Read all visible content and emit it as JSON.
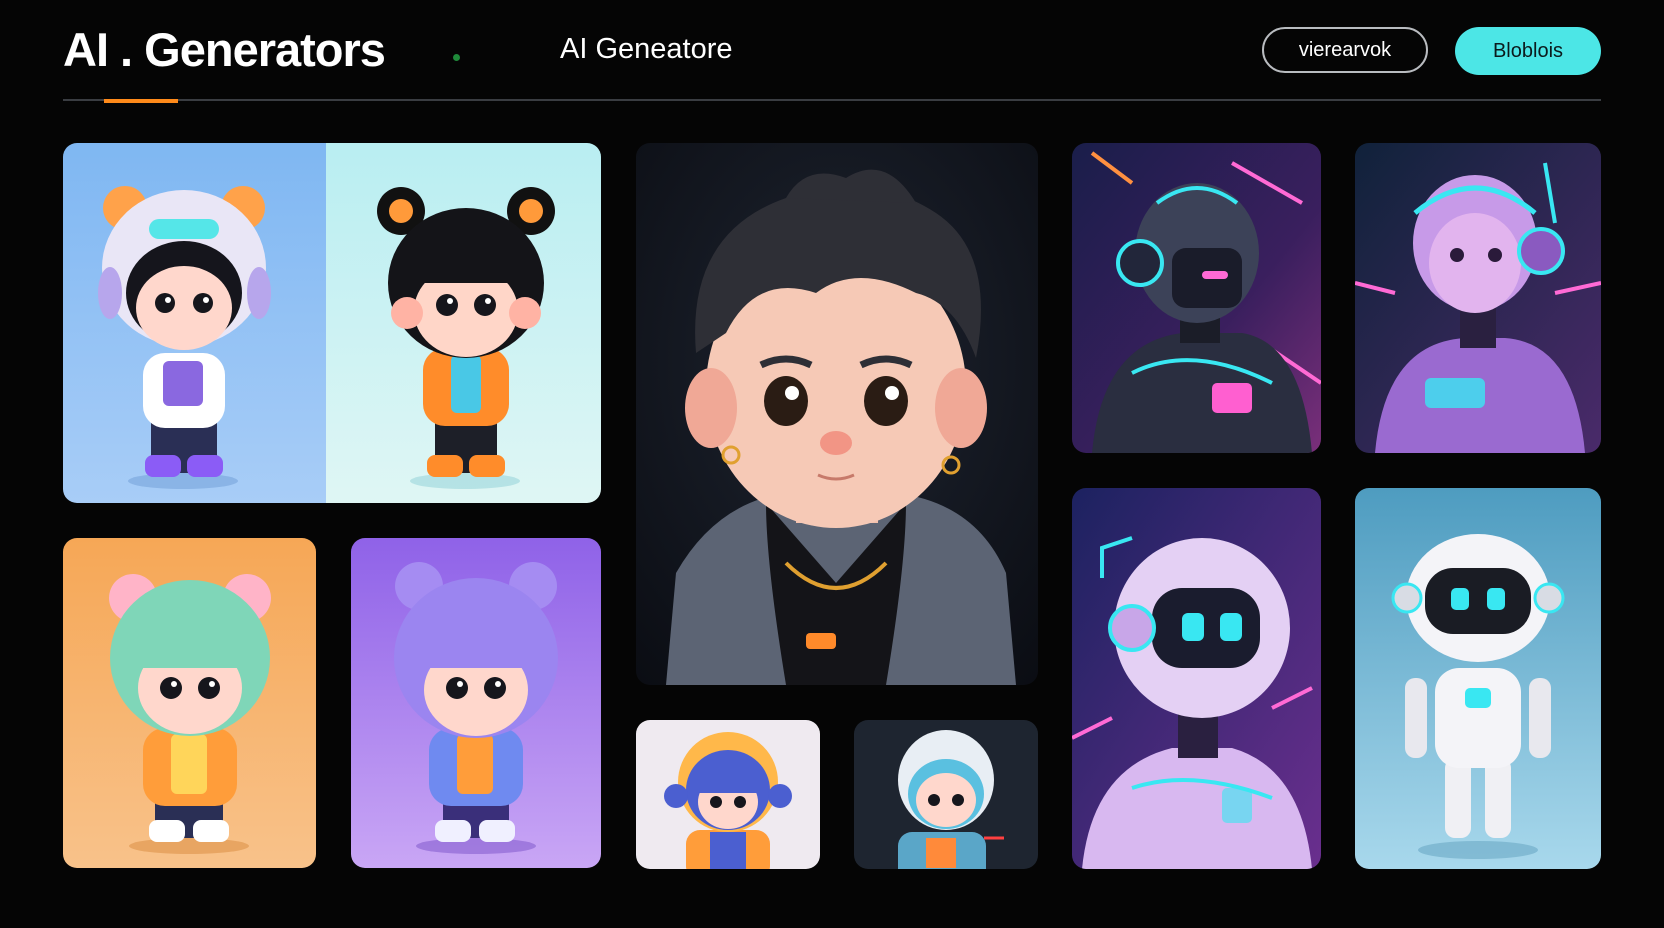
{
  "header": {
    "brand": "AI . Generators",
    "center_title": "AI Geneatore",
    "outline_button": "vierearvok",
    "primary_button": "Bloblois"
  },
  "colors": {
    "background": "#050505",
    "primary_button": "#4ce6e6",
    "tab_accent": "#ff8a1a",
    "status_dot": "#1f8a3a"
  },
  "gallery": {
    "images": [
      {
        "name": "chibi-pair-bear-helmet",
        "subject": "two chibi characters with bear ears"
      },
      {
        "name": "portrait-boy",
        "subject": "stylized boy portrait"
      },
      {
        "name": "neon-robot-cyan",
        "subject": "neon robot with headphones"
      },
      {
        "name": "neon-robot-pink",
        "subject": "pink neon robot"
      },
      {
        "name": "chibi-green-hair",
        "subject": "chibi with mint hair on orange"
      },
      {
        "name": "chibi-purple-hair",
        "subject": "chibi with purple hair on violet"
      },
      {
        "name": "chibi-headphones-blue",
        "subject": "small chibi with headphones"
      },
      {
        "name": "chibi-helmet-dark",
        "subject": "small chibi astronaut"
      },
      {
        "name": "neon-robot-purple",
        "subject": "purple neon robot close-up"
      },
      {
        "name": "robot-white",
        "subject": "white robot full body"
      }
    ]
  }
}
